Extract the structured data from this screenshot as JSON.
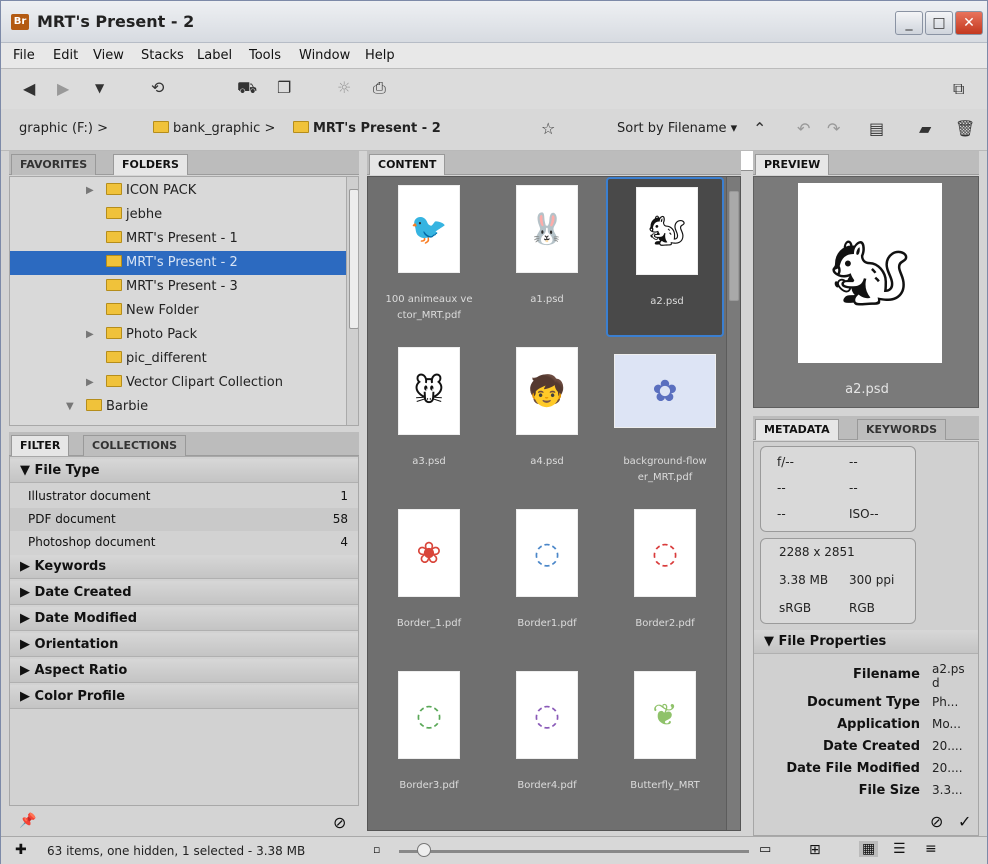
{
  "window": {
    "title": "MRT's Present - 2",
    "min": "_",
    "max": "□",
    "close": "✕"
  },
  "menu": [
    "File",
    "Edit",
    "View",
    "Stacks",
    "Label",
    "Tools",
    "Window",
    "Help"
  ],
  "breadcrumb": [
    {
      "label": "graphic (F:)",
      "sep": ">"
    },
    {
      "label": "bank_graphic",
      "sep": ">"
    },
    {
      "label": "MRT's Present - 2",
      "sep": ""
    }
  ],
  "sort_label": "Sort by Filename",
  "left_tabs": {
    "favorites": "FAVORITES",
    "folders": "FOLDERS"
  },
  "folders": [
    {
      "label": "ICON PACK",
      "expander": "▶",
      "selected": false
    },
    {
      "label": "jebhe",
      "expander": "",
      "selected": false
    },
    {
      "label": "MRT's Present - 1",
      "expander": "",
      "selected": false
    },
    {
      "label": "MRT's Present - 2",
      "expander": "",
      "selected": true
    },
    {
      "label": "MRT's Present - 3",
      "expander": "",
      "selected": false
    },
    {
      "label": "New Folder",
      "expander": "",
      "selected": false
    },
    {
      "label": "Photo Pack",
      "expander": "▶",
      "selected": false
    },
    {
      "label": "pic_different",
      "expander": "",
      "selected": false
    },
    {
      "label": "Vector Clipart Collection",
      "expander": "▶",
      "selected": false
    },
    {
      "label": "Barbie",
      "expander": "▼",
      "selected": false
    }
  ],
  "filter_tabs": {
    "filter": "FILTER",
    "collections": "COLLECTIONS"
  },
  "filter": {
    "file_type_header": "File Type",
    "file_types": [
      {
        "label": "Illustrator document",
        "count": "1"
      },
      {
        "label": "PDF document",
        "count": "58"
      },
      {
        "label": "Photoshop document",
        "count": "4"
      }
    ],
    "sections": [
      "Keywords",
      "Date Created",
      "Date Modified",
      "Orientation",
      "Aspect Ratio",
      "Color Profile"
    ]
  },
  "content_tab": "CONTENT",
  "thumbnails": [
    {
      "caption": "100 animeaux ve ctor_MRT.pdf",
      "glyph": "🐦",
      "selected": false,
      "wide": false
    },
    {
      "caption": "a1.psd",
      "glyph": "🐰",
      "selected": false,
      "wide": false
    },
    {
      "caption": "a2.psd",
      "glyph": "🐿",
      "selected": true,
      "wide": false
    },
    {
      "caption": "a3.psd",
      "glyph": "🐭",
      "selected": false,
      "wide": false
    },
    {
      "caption": "a4.psd",
      "glyph": "🧒",
      "selected": false,
      "wide": false
    },
    {
      "caption": "background-flow er_MRT.pdf",
      "glyph": "✿",
      "selected": false,
      "wide": true
    },
    {
      "caption": "Border_1.pdf",
      "glyph": "❀",
      "selected": false,
      "wide": false
    },
    {
      "caption": "Border1.pdf",
      "glyph": "◌",
      "selected": false,
      "wide": false
    },
    {
      "caption": "Border2.pdf",
      "glyph": "◌",
      "selected": false,
      "wide": false
    },
    {
      "caption": "Border3.pdf",
      "glyph": "◌",
      "selected": false,
      "wide": false
    },
    {
      "caption": "Border4.pdf",
      "glyph": "◌",
      "selected": false,
      "wide": false
    },
    {
      "caption": "Butterfly_MRT",
      "glyph": "❦",
      "selected": false,
      "wide": false
    }
  ],
  "preview": {
    "tab": "PREVIEW",
    "glyph": "🐿",
    "caption": "a2.psd"
  },
  "meta_tabs": {
    "metadata": "METADATA",
    "keywords": "KEYWORDS"
  },
  "metadata": {
    "aperture": "f/--",
    "dash": "--",
    "iso": "ISO--",
    "dimensions": "2288 x 2851",
    "size": "3.38 MB",
    "ppi": "300 ppi",
    "colorspace": "sRGB",
    "mode": "RGB",
    "file_props_header": "File Properties",
    "props": [
      {
        "key": "Filename",
        "value": "a2.ps d"
      },
      {
        "key": "Document Type",
        "value": "Ph..."
      },
      {
        "key": "Application",
        "value": "Mo..."
      },
      {
        "key": "Date Created",
        "value": "20...."
      },
      {
        "key": "Date File Modified",
        "value": "20...."
      },
      {
        "key": "File Size",
        "value": "3.3..."
      }
    ]
  },
  "status": {
    "text": "63 items, one hidden, 1 selected - 3.38 MB"
  },
  "thumb_zoom": 0.05
}
